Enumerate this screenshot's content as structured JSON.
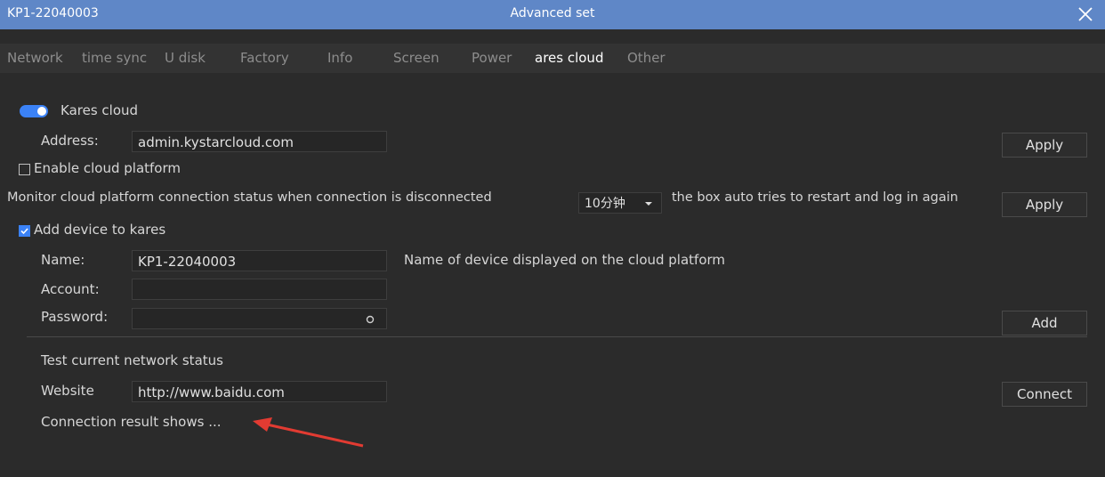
{
  "window": {
    "device_id": "KP1-22040003",
    "title": "Advanced set"
  },
  "tabs": [
    {
      "label": "Network"
    },
    {
      "label": "time sync"
    },
    {
      "label": "U disk"
    },
    {
      "label": "Factory"
    },
    {
      "label": "Info"
    },
    {
      "label": "Screen"
    },
    {
      "label": "Power"
    },
    {
      "label": "ares cloud"
    },
    {
      "label": "Other"
    }
  ],
  "active_tab": "ares cloud",
  "kares": {
    "toggle_label": "Kares cloud",
    "toggle_on": true,
    "address_label": "Address:",
    "address_value": "admin.kystarcloud.com",
    "apply_label": "Apply"
  },
  "cloud_platform": {
    "checkbox_label": "Enable cloud platform",
    "checked": false
  },
  "monitor": {
    "text_before": "Monitor cloud platform connection status when connection is disconnected",
    "interval_value": "10分钟",
    "text_after": "the box auto tries to restart and log in again",
    "apply_label": "Apply"
  },
  "add_device": {
    "checkbox_label": "Add device to kares",
    "checked": true,
    "name_label": "Name:",
    "name_value": "KP1-22040003",
    "name_hint": "Name of device displayed on the cloud platform",
    "account_label": "Account:",
    "account_value": "",
    "password_label": "Password:",
    "password_value": "",
    "add_label": "Add"
  },
  "network_test": {
    "heading": "Test current network status",
    "website_label": "Website",
    "website_value": "http://www.baidu.com",
    "connect_label": "Connect",
    "result_text": "Connection result shows ..."
  },
  "colors": {
    "titlebar": "#5f87c7",
    "accent": "#3b82f6",
    "annotation_arrow": "#e23b32"
  }
}
